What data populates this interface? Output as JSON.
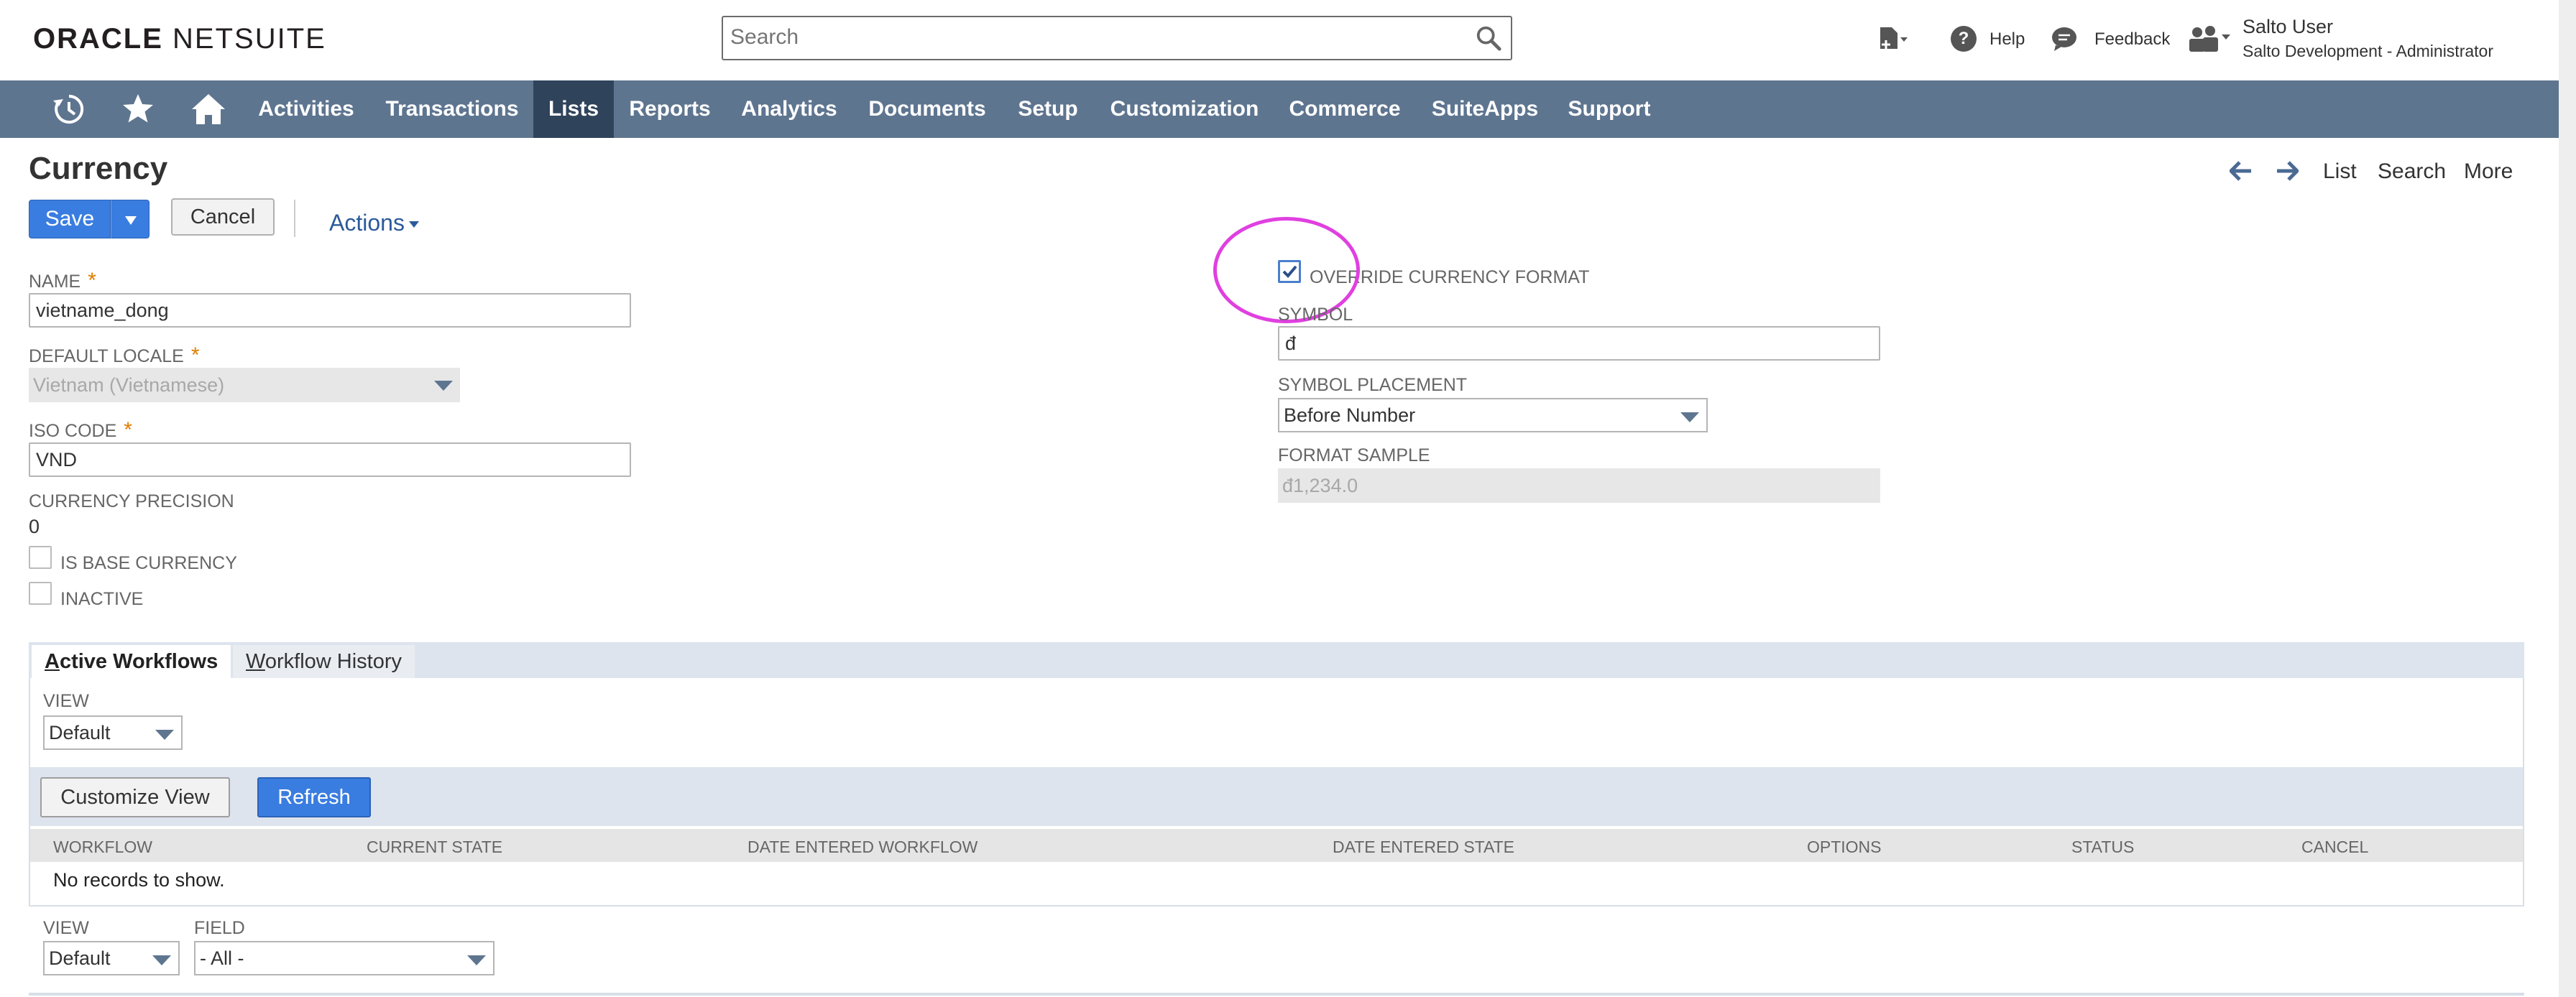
{
  "header": {
    "logo_brand": "ORACLE",
    "logo_product": "NETSUITE",
    "search_placeholder": "Search",
    "help_label": "Help",
    "feedback_label": "Feedback",
    "user_name": "Salto User",
    "user_role": "Salto Development - Administrator"
  },
  "nav": {
    "items": [
      "Activities",
      "Transactions",
      "Lists",
      "Reports",
      "Analytics",
      "Documents",
      "Setup",
      "Customization",
      "Commerce",
      "SuiteApps",
      "Support"
    ],
    "active": "Lists"
  },
  "page": {
    "title": "Currency",
    "save_label": "Save",
    "cancel_label": "Cancel",
    "actions_label": "Actions",
    "top_links": [
      "List",
      "Search",
      "More"
    ]
  },
  "form": {
    "name_label": "NAME",
    "name_value": "vietname_dong",
    "default_locale_label": "DEFAULT LOCALE",
    "default_locale_value": "Vietnam (Vietnamese)",
    "iso_code_label": "ISO CODE",
    "iso_code_value": "VND",
    "currency_precision_label": "CURRENCY PRECISION",
    "currency_precision_value": "0",
    "is_base_currency_label": "IS BASE CURRENCY",
    "is_base_currency_checked": false,
    "inactive_label": "INACTIVE",
    "inactive_checked": false,
    "required_marker": "*",
    "override_label": "OVERRIDE CURRENCY FORMAT",
    "override_checked": true,
    "symbol_label": "SYMBOL",
    "symbol_value": "đ",
    "symbol_placement_label": "SYMBOL PLACEMENT",
    "symbol_placement_value": "Before Number",
    "format_sample_label": "FORMAT SAMPLE",
    "format_sample_value": "đ1,234.0"
  },
  "workflows": {
    "tabs": [
      "Active Workflows",
      "Workflow History"
    ],
    "view_label": "VIEW",
    "view_value": "Default",
    "customize_view_label": "Customize View",
    "refresh_label": "Refresh",
    "columns": [
      "WORKFLOW",
      "CURRENT STATE",
      "DATE ENTERED WORKFLOW",
      "DATE ENTERED STATE",
      "OPTIONS",
      "STATUS",
      "CANCEL"
    ],
    "empty_text": "No records to show.",
    "bottom_view_label": "VIEW",
    "bottom_view_value": "Default",
    "bottom_field_label": "FIELD",
    "bottom_field_value": "- All -"
  },
  "colors": {
    "nav_bg": "#5e7590",
    "nav_active_bg": "#2f435b",
    "primary_button": "#3a7de0",
    "highlight_ring": "#e040e0",
    "required_marker": "#e07c00"
  }
}
